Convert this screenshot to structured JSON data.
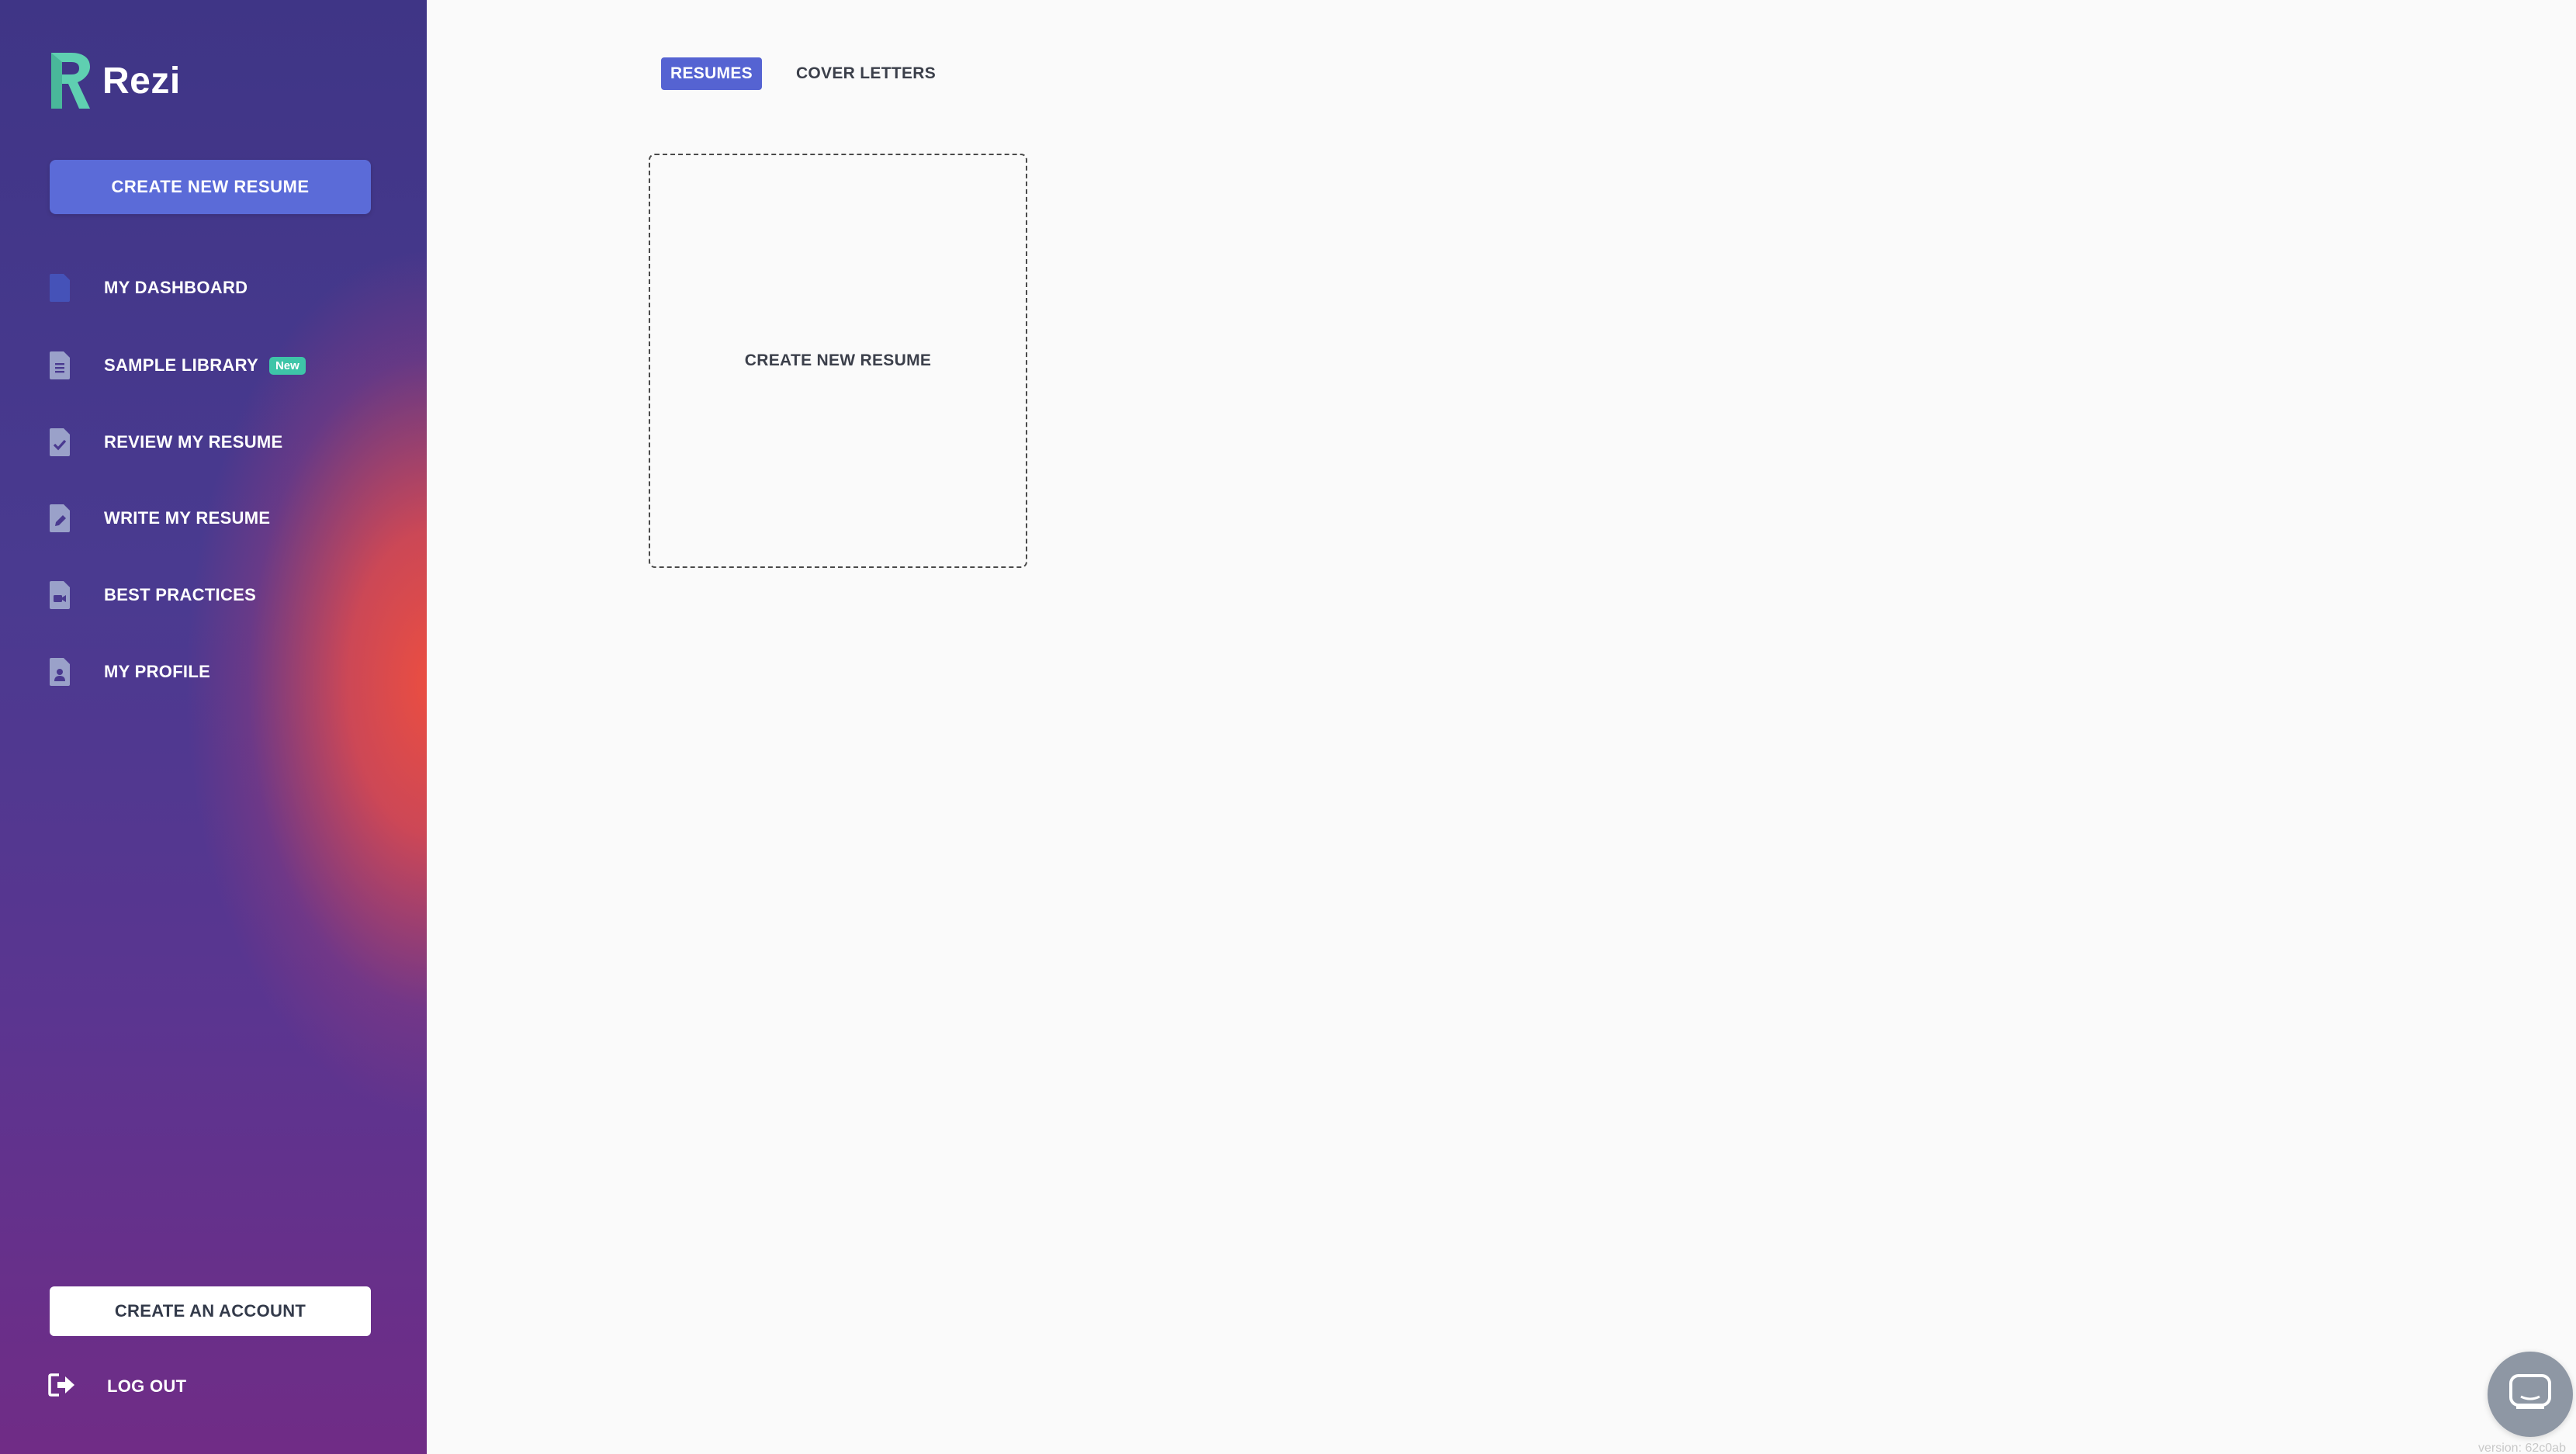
{
  "brand": {
    "name": "Rezi",
    "logo_color": "#5fcfb1"
  },
  "sidebar": {
    "create_button_label": "CREATE NEW RESUME",
    "items": [
      {
        "label": "MY DASHBOARD",
        "icon": "document-icon"
      },
      {
        "label": "SAMPLE LIBRARY",
        "icon": "document-lines-icon",
        "badge": "New"
      },
      {
        "label": "REVIEW MY RESUME",
        "icon": "document-check-icon"
      },
      {
        "label": "WRITE MY RESUME",
        "icon": "document-pencil-icon"
      },
      {
        "label": "BEST PRACTICES",
        "icon": "document-video-icon"
      },
      {
        "label": "MY PROFILE",
        "icon": "document-person-icon"
      }
    ],
    "create_account_label": "CREATE AN ACCOUNT",
    "logout_label": "LOG OUT"
  },
  "main": {
    "tabs": [
      {
        "label": "RESUMES",
        "active": true
      },
      {
        "label": "COVER LETTERS",
        "active": false
      }
    ],
    "new_resume_card_label": "CREATE NEW RESUME"
  },
  "footer": {
    "version": "version: 62c0ab"
  },
  "colors": {
    "accent": "#5563d2",
    "button": "#5b6bd8",
    "badge": "#3ec5a8",
    "icon": "#9aa1c9"
  }
}
